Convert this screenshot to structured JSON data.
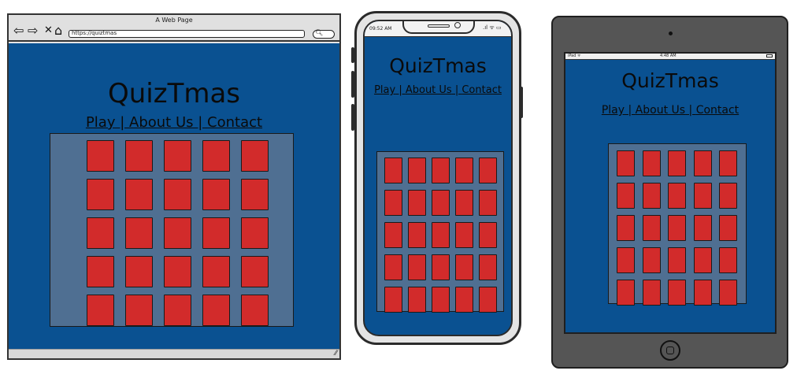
{
  "browser": {
    "window_title": "A Web Page",
    "url": "https://quiztmas",
    "nav_icons": [
      "back-arrow-icon",
      "forward-arrow-icon",
      "close-icon",
      "home-icon"
    ],
    "search_icon": "search-icon"
  },
  "site": {
    "title": "QuizTmas",
    "nav": [
      "Play",
      "About Us",
      "Contact"
    ],
    "separator": " | ",
    "board": {
      "rows": 5,
      "cols": 5
    }
  },
  "phone": {
    "time": "09:52 AM",
    "status_icons": ".ıl ᯤ ▭"
  },
  "tablet": {
    "carrier": "iPad ᯤ",
    "time": "4:48 AM"
  },
  "colors": {
    "page_background": "#0a5191",
    "board": "#4f6f92",
    "tile": "#d22b2b",
    "text": "#0a0a0a"
  }
}
